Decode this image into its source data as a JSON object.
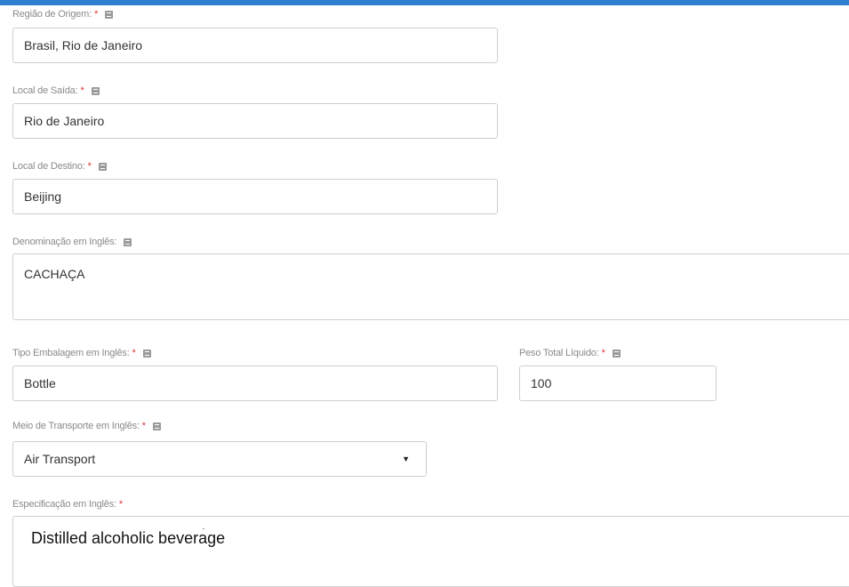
{
  "form": {
    "regiao": {
      "label": "Região de Origem:",
      "required": "*",
      "value": "Brasil,  Rio de Janeiro"
    },
    "local_saida": {
      "label": "Local de Saída:",
      "required": "*",
      "value": "Rio de Janeiro"
    },
    "local_destino": {
      "label": "Local de Destino:",
      "required": "*",
      "value": "Beijing"
    },
    "denominacao": {
      "label": "Denominação em Inglês:",
      "value": "CACHAÇA"
    },
    "tipo_embalagem": {
      "label": "Tipo Embalagem em Inglês:",
      "required": "*",
      "value": "Bottle"
    },
    "peso_total": {
      "label": "Peso Total Líquido:",
      "required": "*",
      "value": "100"
    },
    "meio_transporte": {
      "label": "Meio de Transporte em Inglês:",
      "required": "*",
      "value": "Air Transport",
      "caret": "▼"
    },
    "especificacao": {
      "label": "Especificação em Inglês:",
      "required": "*",
      "value": "Distilled alcoholic beverage"
    }
  },
  "colors": {
    "accent_bar": "#2f7fd1",
    "required_star": "#e03030",
    "border": "#cfcfcf"
  },
  "icons": {
    "help": "help-icon"
  }
}
